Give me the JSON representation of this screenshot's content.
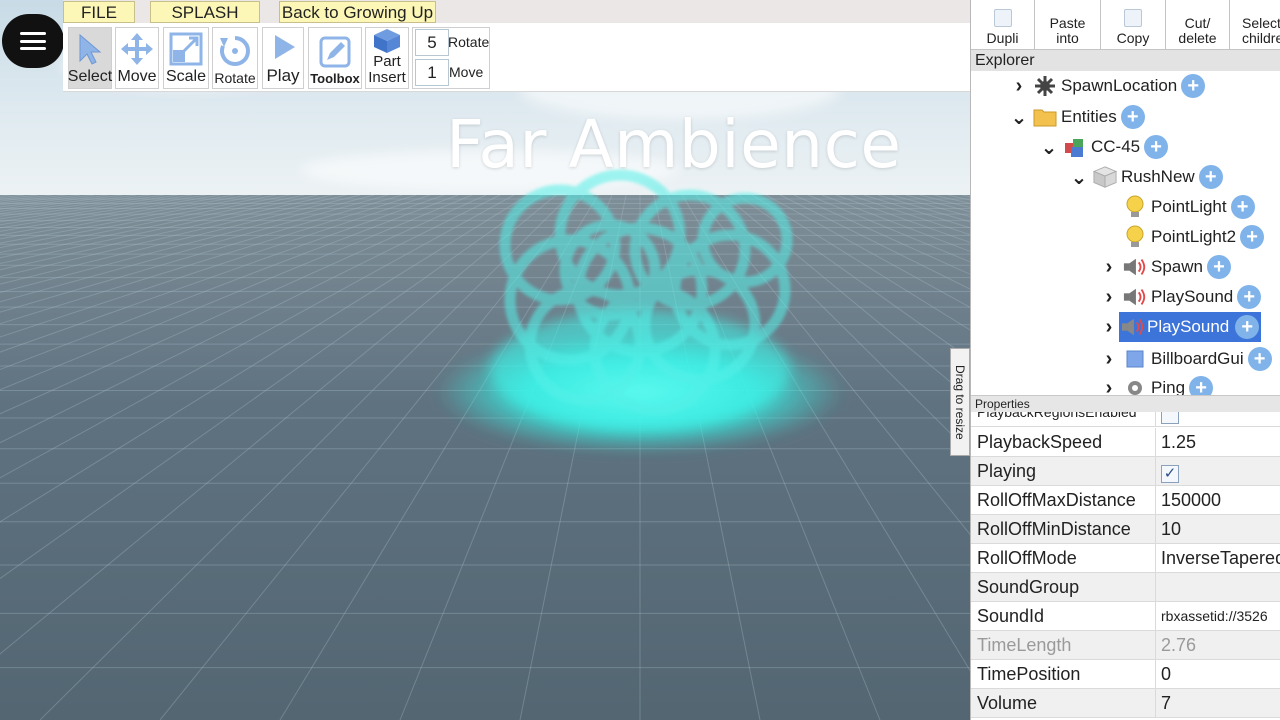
{
  "menu": {
    "file": "FILE",
    "splash": "SPLASH",
    "back": "Back to Growing Up"
  },
  "toolbar": {
    "tools": [
      {
        "id": "select",
        "label": "Select",
        "icon": "cursor-icon",
        "active": true
      },
      {
        "id": "move",
        "label": "Move",
        "icon": "move-arrows-icon"
      },
      {
        "id": "scale",
        "label": "Scale",
        "icon": "scale-icon"
      },
      {
        "id": "rotate",
        "label": "Rotate",
        "icon": "rotate-icon"
      },
      {
        "id": "play",
        "label": "Play",
        "icon": "play-icon"
      },
      {
        "id": "toolbox",
        "label": "Toolbox",
        "icon": "toolbox-icon"
      },
      {
        "id": "part-insert",
        "label_top": "Part",
        "label": "Insert",
        "icon": "cube-icon"
      }
    ],
    "rotate_step": {
      "value": "5",
      "label": "Rotate"
    },
    "move_step": {
      "value": "1",
      "label": "Move"
    }
  },
  "overlay": {
    "title": "Far Ambience"
  },
  "actions": [
    {
      "id": "duplicate",
      "label": "Dupli",
      "label2": ""
    },
    {
      "id": "paste-into",
      "label": "Paste",
      "label2": "into"
    },
    {
      "id": "copy",
      "label": "Copy",
      "label2": ""
    },
    {
      "id": "cut-delete",
      "label": "Cut/",
      "label2": "delete"
    },
    {
      "id": "select-children",
      "label": "Select",
      "label2": "children"
    }
  ],
  "explorer": {
    "title": "Explorer",
    "items": [
      {
        "label": "SpawnLocation",
        "icon": "spawn-location-icon",
        "chevron": "right"
      },
      {
        "label": "Entities",
        "icon": "folder-icon",
        "chevron": "down"
      },
      {
        "label": "CC-45",
        "icon": "model-icon",
        "chevron": "down"
      },
      {
        "label": "RushNew",
        "icon": "part-icon",
        "chevron": "down"
      },
      {
        "label": "PointLight",
        "icon": "light-bulb-icon",
        "chevron": ""
      },
      {
        "label": "PointLight2",
        "icon": "light-bulb-icon",
        "chevron": ""
      },
      {
        "label": "Spawn",
        "icon": "sound-icon",
        "chevron": "right"
      },
      {
        "label": "PlaySound",
        "icon": "sound-icon",
        "chevron": "right"
      },
      {
        "label": "PlaySound",
        "icon": "sound-icon",
        "chevron": "right",
        "selected": true
      },
      {
        "label": "BillboardGui",
        "icon": "billboard-gui-icon",
        "chevron": "right"
      },
      {
        "label": "Ping",
        "icon": "gear-icon",
        "chevron": "right"
      }
    ]
  },
  "resize_handle": {
    "label": "Drag to resize"
  },
  "properties": {
    "title": "Properties",
    "rows": [
      {
        "name": "PlaybackRegionsEnabled",
        "value": "",
        "type": "checkbox",
        "checked": false
      },
      {
        "name": "PlaybackSpeed",
        "value": "1.25"
      },
      {
        "name": "Playing",
        "value": "",
        "type": "checkbox",
        "checked": true
      },
      {
        "name": "RollOffMaxDistance",
        "value": "150000"
      },
      {
        "name": "RollOffMinDistance",
        "value": "10"
      },
      {
        "name": "RollOffMode",
        "value": "InverseTapered"
      },
      {
        "name": "SoundGroup",
        "value": ""
      },
      {
        "name": "SoundId",
        "value": "rbxassetid://3526"
      },
      {
        "name": "TimeLength",
        "value": "2.76",
        "disabled": true
      },
      {
        "name": "TimePosition",
        "value": "0"
      },
      {
        "name": "Volume",
        "value": "7"
      }
    ],
    "checkmark": "✓"
  },
  "colors": {
    "selection": "#3d74d9",
    "plus": "#7fb3ea",
    "glow": "#35f2e6",
    "menu_tab": "#fcf7b6"
  }
}
